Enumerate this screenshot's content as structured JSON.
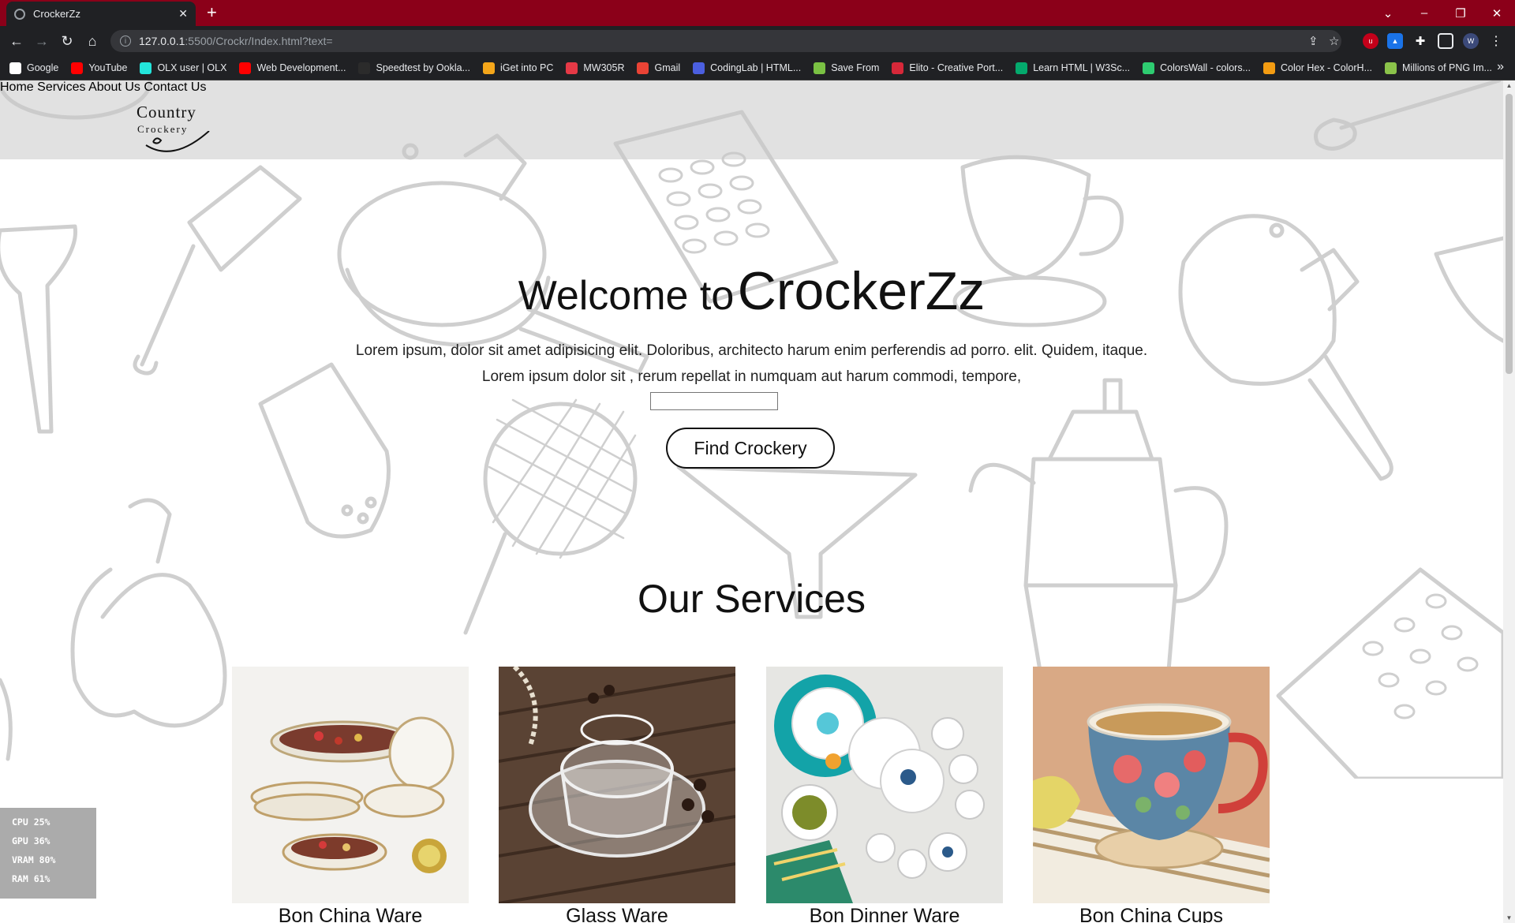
{
  "browser": {
    "tab_title": "CrockerZz",
    "tab_close": "✕",
    "new_tab": "+",
    "url_host": "127.0.0.1",
    "url_path": ":5500/Crockr/Index.html?text=",
    "window_controls": [
      "⌄",
      "–",
      "❐",
      "✕"
    ],
    "bookmarks": [
      {
        "label": "Google",
        "color": "#ffffff"
      },
      {
        "label": "YouTube",
        "color": "#ff0000"
      },
      {
        "label": "OLX user | OLX",
        "color": "#23e5db"
      },
      {
        "label": "Web Development...",
        "color": "#ff0000"
      },
      {
        "label": "Speedtest by Ookla...",
        "color": "#2b2b2b"
      },
      {
        "label": "iGet into PC",
        "color": "#f4a61a"
      },
      {
        "label": "MW305R",
        "color": "#e63946"
      },
      {
        "label": "Gmail",
        "color": "#ea4335"
      },
      {
        "label": "CodingLab | HTML...",
        "color": "#4b5fe0"
      },
      {
        "label": "Save From",
        "color": "#7ac143"
      },
      {
        "label": "Elito - Creative Port...",
        "color": "#d62839"
      },
      {
        "label": "Learn HTML | W3Sc...",
        "color": "#04aa6d"
      },
      {
        "label": "ColorsWall - colors...",
        "color": "#2ecc71"
      },
      {
        "label": "Color Hex - ColorH...",
        "color": "#f39c12"
      },
      {
        "label": "Millions of PNG Im...",
        "color": "#8bc34a"
      }
    ],
    "bookmarks_more": "»"
  },
  "site": {
    "logo_line1": "Country",
    "logo_line2": "Crockery",
    "nav": [
      "Home",
      "Services",
      "About Us",
      "Contact Us"
    ],
    "hero": {
      "welcome": "Welcome to",
      "brand": "CrockerZz",
      "line1": "Lorem ipsum, dolor sit amet adipisicing elit. Doloribus, architecto harum enim perferendis ad porro. elit. Quidem, itaque.",
      "line2": "Lorem ipsum dolor sit , rerum repellat in numquam aut harum commodi, tempore,",
      "search_value": "",
      "button": "Find Crockery"
    },
    "services_title": "Our Services",
    "services": [
      {
        "caption": "Bon China Ware"
      },
      {
        "caption": "Glass Ware"
      },
      {
        "caption": "Bon Dinner Ware"
      },
      {
        "caption": "Bon China Cups"
      }
    ]
  },
  "overlay": {
    "stats": [
      "CPU  25%",
      "GPU  36%",
      "VRAM  80%",
      "RAM  61%"
    ]
  },
  "colors": {
    "tabbar": "#8b0019",
    "chrome_dark": "#202124"
  }
}
